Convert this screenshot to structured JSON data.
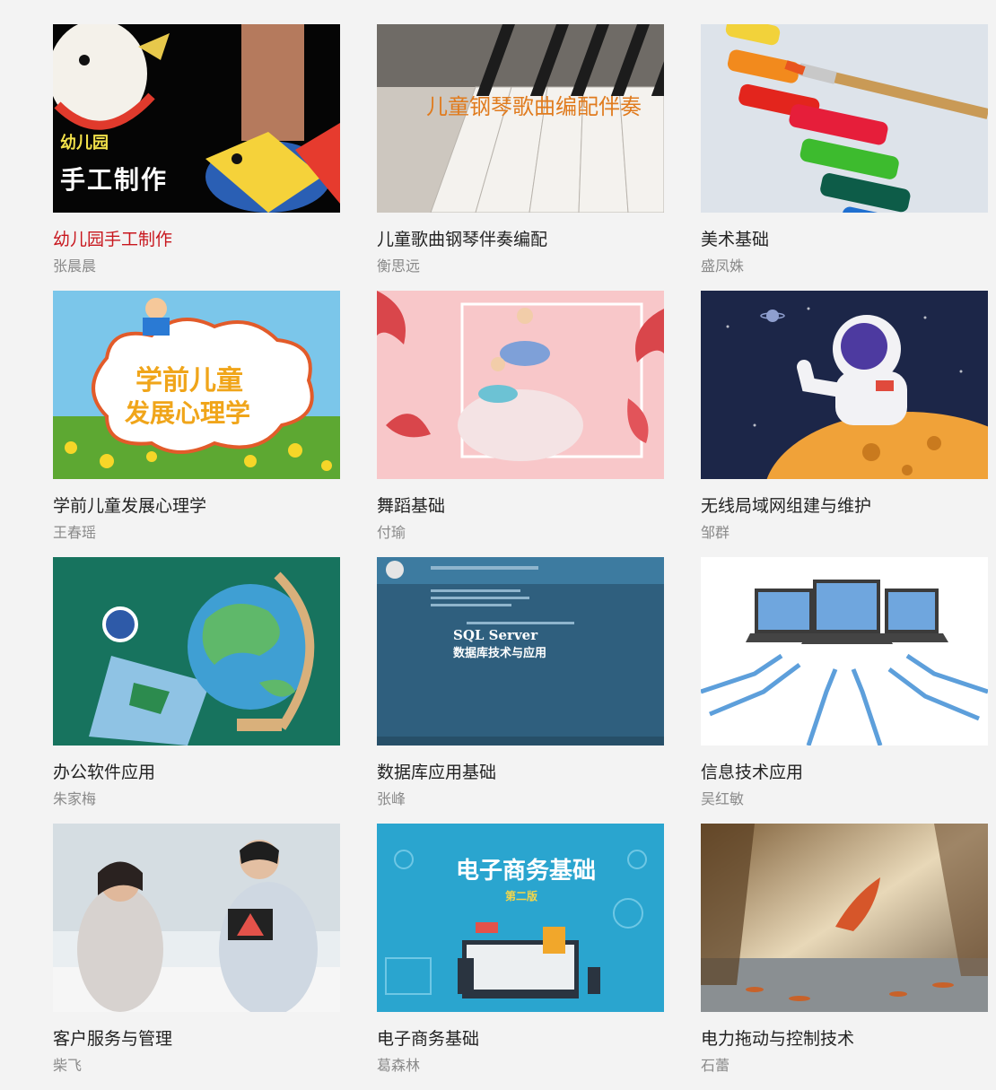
{
  "courses": [
    {
      "title": "幼儿园手工制作",
      "teacher": "张晨晨",
      "overlay": [
        "幼儿园",
        "手工制作"
      ],
      "active": true
    },
    {
      "title": "儿童歌曲钢琴伴奏编配",
      "teacher": "衡思远",
      "overlay": [
        "儿童钢琴歌曲编配伴奏"
      ]
    },
    {
      "title": "美术基础",
      "teacher": "盛凤姝"
    },
    {
      "title": "学前儿童发展心理学",
      "teacher": "王春瑶",
      "overlay": [
        "学前儿童",
        "发展心理学"
      ]
    },
    {
      "title": "舞蹈基础",
      "teacher": "付瑜"
    },
    {
      "title": "无线局域网组建与维护",
      "teacher": "邹群"
    },
    {
      "title": "办公软件应用",
      "teacher": "朱家梅"
    },
    {
      "title": "数据库应用基础",
      "teacher": "张峰",
      "overlay": [
        "SQL Server",
        "数据库技术与应用"
      ]
    },
    {
      "title": "信息技术应用",
      "teacher": "吴红敏"
    },
    {
      "title": "客户服务与管理",
      "teacher": "柴飞"
    },
    {
      "title": "电子商务基础",
      "teacher": "葛森林",
      "overlay": [
        "电子商务基础",
        "第二版"
      ]
    },
    {
      "title": "电力拖动与控制技术",
      "teacher": "石蕾"
    }
  ],
  "colors": {
    "active_title": "#c8171e",
    "title": "#222222",
    "teacher": "#8a8a8a",
    "background": "#f3f3f3"
  }
}
